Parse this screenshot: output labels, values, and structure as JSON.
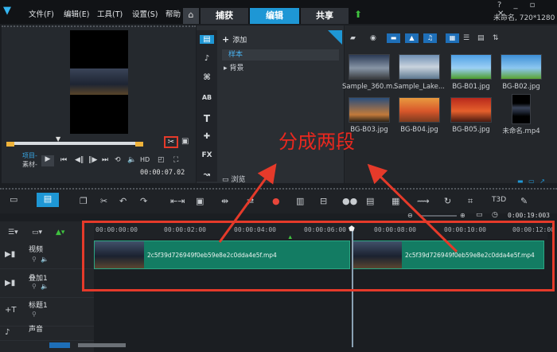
{
  "app": {
    "menu": [
      "文件(F)",
      "编辑(E)",
      "工具(T)",
      "设置(S)",
      "帮助"
    ],
    "tabs": [
      {
        "label": "捕获"
      },
      {
        "label": "编辑"
      },
      {
        "label": "共享"
      }
    ],
    "project_info": "未命名, 720*1280"
  },
  "player": {
    "mode_project": "项目-",
    "mode_clip": "素材-",
    "timecode": "00:00:07.02"
  },
  "library": {
    "add_label": "添加",
    "items": [
      "样本",
      "背景"
    ],
    "browse_label": "浏览"
  },
  "media": {
    "thumbnails": [
      {
        "label": "Sample_360.m..."
      },
      {
        "label": "Sample_Lake..."
      },
      {
        "label": "BG-B01.jpg"
      },
      {
        "label": "BG-B02.jpg"
      },
      {
        "label": "BG-B03.jpg"
      },
      {
        "label": "BG-B04.jpg"
      },
      {
        "label": "BG-B05.jpg"
      },
      {
        "label": "未命名.mp4"
      }
    ]
  },
  "annotation": {
    "text": "分成两段"
  },
  "timeline": {
    "total_time": "0:00:19:003",
    "ruler_ticks": [
      "00:00:00:00",
      "00:00:02:00",
      "00:00:04:00",
      "00:00:06:00",
      "00:00:08:00",
      "00:00:10:00",
      "00:00:12:00"
    ],
    "tracks": [
      "视频",
      "叠加1",
      "标题1",
      "声音"
    ],
    "clips": [
      {
        "name": "2c5f39d726949f0eb59e8e2c0dda4e5f.mp4"
      },
      {
        "name": "2c5f39d726949f0eb59e8e2c0dda4e5f.mp4"
      }
    ]
  },
  "colors": {
    "accent": "#1e97d5",
    "clip": "#137c63",
    "annotation": "#e53a2a"
  }
}
